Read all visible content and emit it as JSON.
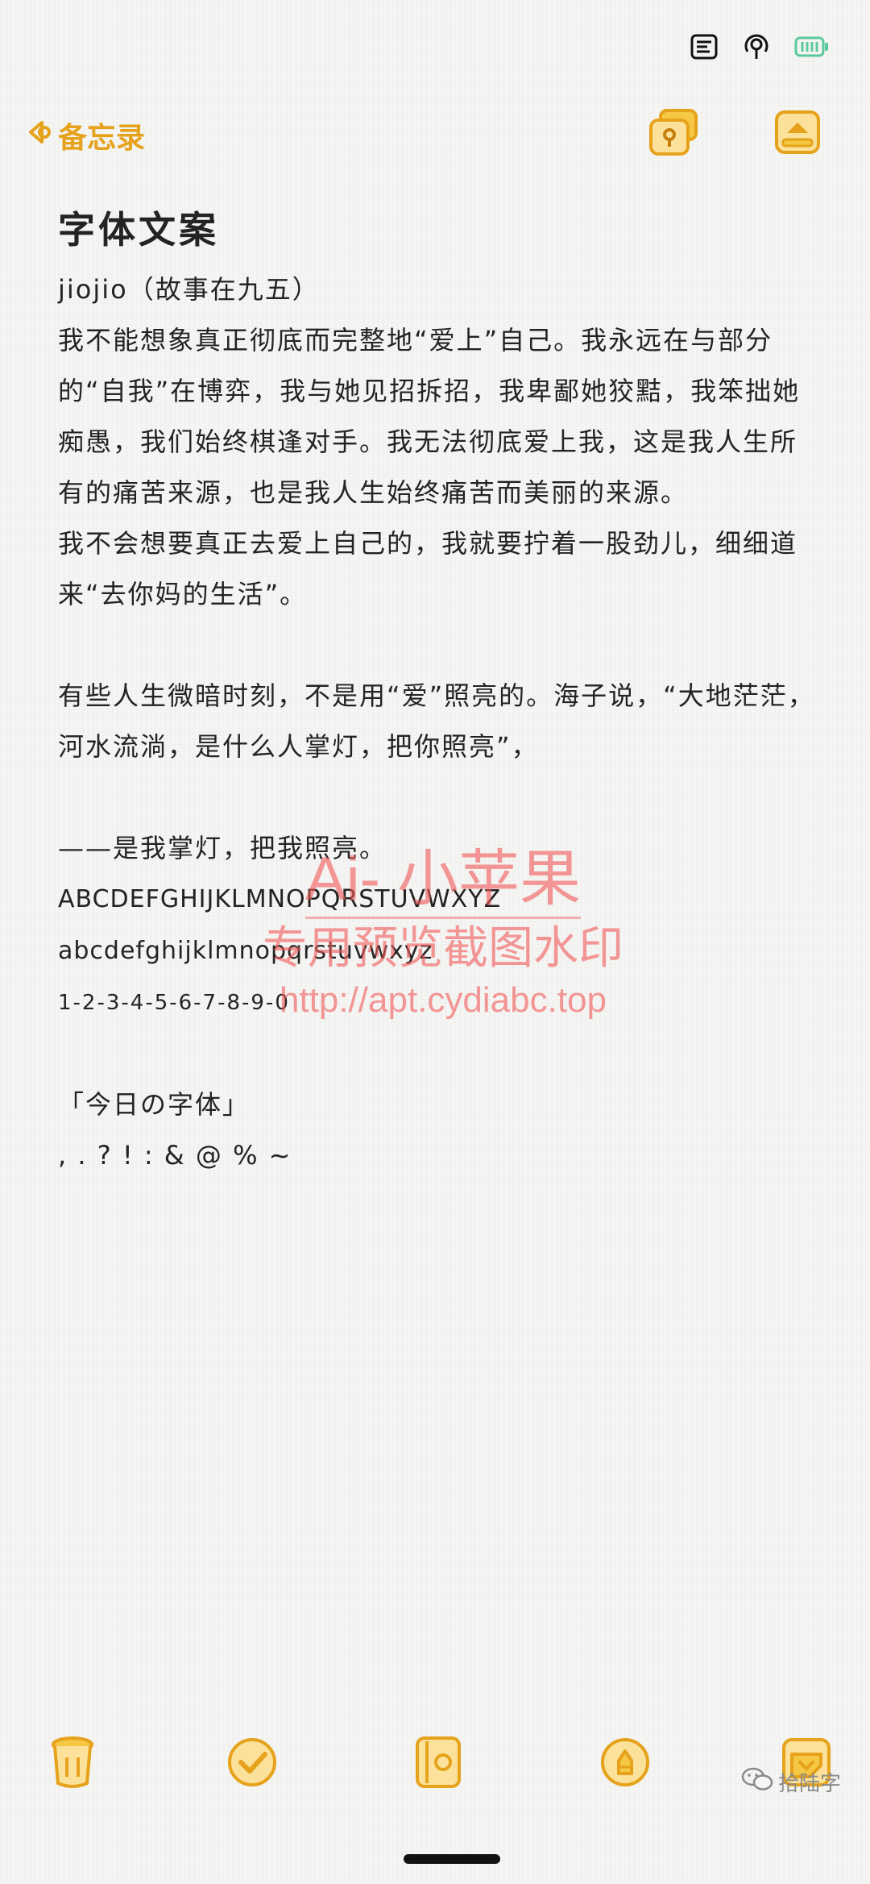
{
  "nav": {
    "back_label": "备忘录"
  },
  "note": {
    "title": "字体文案",
    "lines": [
      "jiojio（故事在九五）",
      "我不能想象真正彻底而完整地“爱上”自己。我永远在与部分的“自我”在博弈，我与她见招拆招，我卑鄙她狡黠，我笨拙她痴愚，我们始终棋逢对手。我无法彻底爱上我，这是我人生所有的痛苦来源，也是我人生始终痛苦而美丽的来源。",
      "我不会想要真正去爱上自己的，我就要拧着一股劲儿，细细道来“去你妈的生活”。",
      "",
      "有些人生微暗时刻，不是用“爱”照亮的。海子说，“大地茫茫，河水流淌，是什么人掌灯，把你照亮”，",
      "",
      "——是我掌灯，把我照亮。"
    ],
    "sample_upper": "ABCDEFGHIJKLMNOPQRSTUVWXYZ",
    "sample_lower": "abcdefghijklmnopqrstuvwxyz",
    "sample_digits": "1-2-3-4-5-6-7-8-9-0",
    "blank_after_digits": "",
    "font_tag": "「今日の字体」",
    "punctuation": ", . ? ! : & @ % ~"
  },
  "watermark": {
    "line1": "Ai- 小苹果",
    "line2": "专用预览截图水印",
    "line3": "http://apt.cydiabc.top"
  },
  "credit": {
    "label": "拾陆字"
  },
  "colors": {
    "accent": "#e6a21a",
    "battery": "#5cc8a0",
    "text": "#232323",
    "watermark": "#f05a5a"
  },
  "icons": {
    "status": [
      "notes-status-icon",
      "hotspot-icon",
      "battery-icon"
    ],
    "nav": [
      "lock-icon",
      "share-icon"
    ],
    "toolbar": [
      "trash-icon",
      "checklist-icon",
      "camera-icon",
      "pen-icon",
      "compose-icon"
    ]
  }
}
